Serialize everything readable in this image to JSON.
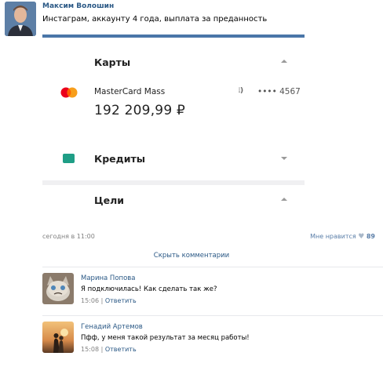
{
  "post": {
    "author": "Максим Волошин",
    "text": "Инстаграм, аккаунту 4 года, выплата за преданность",
    "time": "сегодня в 11:00",
    "likes_label": "Мне нравится",
    "likes_count": "89"
  },
  "screenshot": {
    "cards_title": "Карты",
    "card_name": "MasterCard Mass",
    "card_number": "•••• 4567",
    "card_amount": "192 209,99 ₽",
    "credits_title": "Кредиты",
    "goals_title": "Цели"
  },
  "hide_comments": "Скрыть комментарии",
  "comments": [
    {
      "name": "Марина Попова",
      "text": "Я подключилась! Как сделать так же?",
      "time": "15:06",
      "reply": "Ответить"
    },
    {
      "name": "Генадий Артемов",
      "text": "Пфф, у меня такой результат за месяц работы!",
      "time": "15:08",
      "reply": "Ответить"
    }
  ],
  "colors": {
    "link": "#2a5885",
    "accent": "#4a76a8",
    "wallet": "#1f9e86"
  }
}
